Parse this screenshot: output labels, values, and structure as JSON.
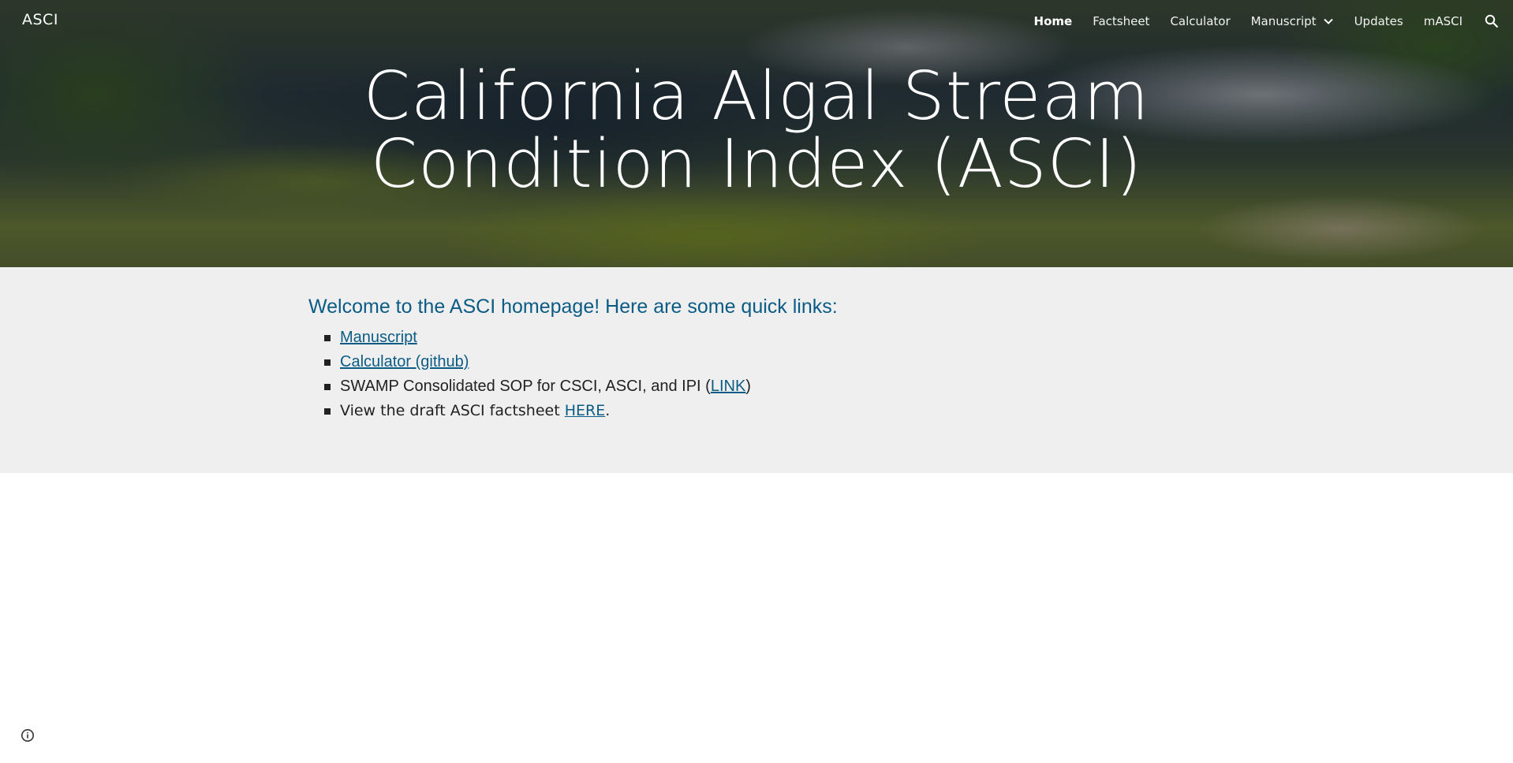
{
  "site": {
    "title": "ASCI"
  },
  "nav": {
    "items": [
      {
        "label": "Home",
        "active": true
      },
      {
        "label": "Factsheet"
      },
      {
        "label": "Calculator"
      },
      {
        "label": "Manuscript",
        "has_dropdown": true,
        "dropdown_icon": "chevron-down-icon"
      },
      {
        "label": "Updates"
      },
      {
        "label": "mASCI"
      }
    ],
    "search_icon": "search-icon"
  },
  "hero": {
    "title_line1": "California Algal Stream",
    "title_line2": "Condition Index (ASCI)"
  },
  "content": {
    "welcome": "Welcome to the ASCI homepage! Here are some quick links:",
    "links": {
      "manuscript": "Manuscript",
      "calculator": "Calculator (github)",
      "sop_prefix": "SWAMP Consolidated SOP for CSCI, ASCI, and IPI (",
      "sop_link": "LINK",
      "sop_suffix": ")",
      "factsheet_prefix": "View the draft ASCI factsheet ",
      "factsheet_link": "HERE",
      "factsheet_suffix": "."
    }
  },
  "footer": {
    "info_icon": "info-icon"
  },
  "colors": {
    "link": "#0b5c85",
    "band": "#efefef",
    "text": "#212121"
  }
}
